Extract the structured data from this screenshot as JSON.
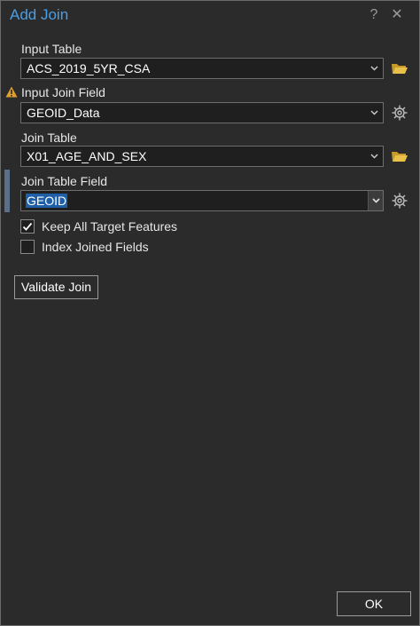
{
  "window": {
    "title": "Add Join",
    "help_glyph": "?",
    "close_glyph": "✕"
  },
  "fields": {
    "input_table": {
      "label": "Input Table",
      "value": "ACS_2019_5YR_CSA"
    },
    "input_join_field": {
      "label": "Input Join Field",
      "value": "GEOID_Data",
      "warning_icon": "warning-icon"
    },
    "join_table": {
      "label": "Join Table",
      "value": "X01_AGE_AND_SEX"
    },
    "join_table_field": {
      "label": "Join Table Field",
      "value": "GEOID"
    }
  },
  "options": {
    "keep_all": {
      "label": "Keep All Target Features",
      "checked": true
    },
    "index_joined": {
      "label": "Index Joined Fields",
      "checked": false
    }
  },
  "buttons": {
    "validate": "Validate Join",
    "ok": "OK"
  },
  "colors": {
    "title": "#4a9fe6",
    "background": "#2b2b2b",
    "selection": "#1f5fa8",
    "folder": "#e8c04a",
    "warning": "#e0a030"
  }
}
